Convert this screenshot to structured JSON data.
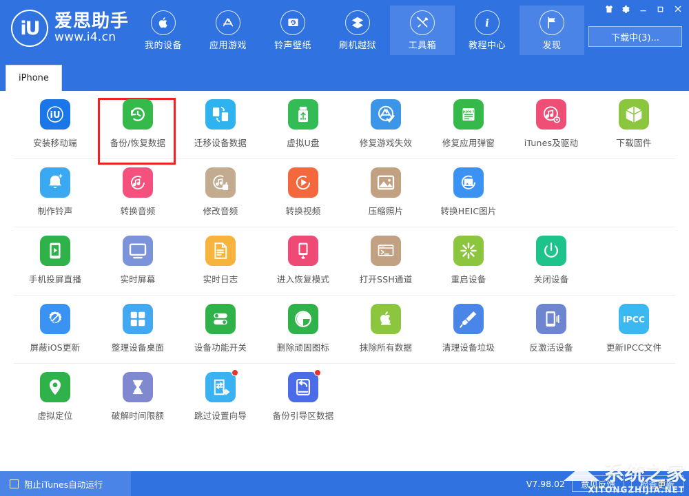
{
  "app": {
    "logo_mark": "iU",
    "logo_name": "爱思助手",
    "logo_url": "www.i4.cn"
  },
  "header": {
    "nav": [
      {
        "label": "我的设备",
        "icon": "apple-icon",
        "active": false
      },
      {
        "label": "应用游戏",
        "icon": "appstore-icon",
        "active": false
      },
      {
        "label": "铃声壁纸",
        "icon": "ringtone-icon",
        "active": false
      },
      {
        "label": "刷机越狱",
        "icon": "flash-icon",
        "active": false
      },
      {
        "label": "工具箱",
        "icon": "toolbox-icon",
        "active": true
      },
      {
        "label": "教程中心",
        "icon": "info-icon",
        "active": false
      },
      {
        "label": "发现",
        "icon": "flag-icon",
        "active": true
      }
    ],
    "window_buttons": [
      {
        "name": "skin-icon",
        "glyph": "shirt"
      },
      {
        "name": "settings-gear-icon",
        "glyph": "gear"
      },
      {
        "name": "minimize-button",
        "glyph": "minimize"
      },
      {
        "name": "maximize-button",
        "glyph": "maximize"
      },
      {
        "name": "close-button",
        "glyph": "close"
      }
    ],
    "download_button": "下载中(3)..."
  },
  "tabs": [
    {
      "label": "iPhone",
      "active": true
    }
  ],
  "toolbox": {
    "rows": [
      {
        "items": [
          {
            "label": "安装移动端",
            "icon": "i4-install-icon",
            "color": "#1b76e8",
            "badge": false
          },
          {
            "label": "备份/恢复数据",
            "icon": "backup-restore-icon",
            "color": "#35b94b",
            "badge": false,
            "highlighted": true
          },
          {
            "label": "迁移设备数据",
            "icon": "migrate-data-icon",
            "color": "#2eb3ef",
            "badge": false
          },
          {
            "label": "虚拟U盘",
            "icon": "usb-disk-icon",
            "color": "#33bb55",
            "badge": false
          },
          {
            "label": "修复游戏失效",
            "icon": "fix-game-icon",
            "color": "#3d95e8",
            "badge": false
          },
          {
            "label": "修复应用弹窗",
            "icon": "appleid-fix-icon",
            "color": "#35b94b",
            "badge": false
          },
          {
            "label": "iTunes及驱动",
            "icon": "itunes-driver-icon",
            "color": "#ef4f77",
            "badge": false
          },
          {
            "label": "下载固件",
            "icon": "firmware-box-icon",
            "color": "#8cc63f",
            "badge": false
          }
        ]
      },
      {
        "items": [
          {
            "label": "制作铃声",
            "icon": "make-ringtone-icon",
            "color": "#3aa9f2",
            "badge": false
          },
          {
            "label": "转换音频",
            "icon": "convert-audio-icon",
            "color": "#f4517f",
            "badge": false
          },
          {
            "label": "修改音频",
            "icon": "edit-audio-icon",
            "color": "#c2ab8e",
            "badge": false
          },
          {
            "label": "转换视频",
            "icon": "convert-video-icon",
            "color": "#f4683e",
            "badge": false
          },
          {
            "label": "压缩照片",
            "icon": "compress-photo-icon",
            "color": "#c2a183",
            "badge": false
          },
          {
            "label": "转换HEIC图片",
            "icon": "heic-convert-icon",
            "color": "#3a92f2",
            "badge": false
          }
        ]
      },
      {
        "items": [
          {
            "label": "手机投屏直播",
            "icon": "screen-cast-icon",
            "color": "#2fb24a",
            "badge": false
          },
          {
            "label": "实时屏幕",
            "icon": "live-screen-icon",
            "color": "#7b93d8",
            "badge": false
          },
          {
            "label": "实时日志",
            "icon": "live-log-icon",
            "color": "#f6b33d",
            "badge": false
          },
          {
            "label": "进入恢复模式",
            "icon": "recovery-mode-icon",
            "color": "#ee4a75",
            "badge": false
          },
          {
            "label": "打开SSH通道",
            "icon": "ssh-terminal-icon",
            "color": "#c2a183",
            "badge": false
          },
          {
            "label": "重启设备",
            "icon": "restart-device-icon",
            "color": "#8cc63f",
            "badge": false
          },
          {
            "label": "关闭设备",
            "icon": "power-off-icon",
            "color": "#1ec28b",
            "badge": false
          }
        ]
      },
      {
        "items": [
          {
            "label": "屏蔽iOS更新",
            "icon": "block-update-icon",
            "color": "#3a92f2",
            "badge": false
          },
          {
            "label": "整理设备桌面",
            "icon": "arrange-home-icon",
            "color": "#42a8ef",
            "badge": false
          },
          {
            "label": "设备功能开关",
            "icon": "feature-toggle-icon",
            "color": "#2fb24a",
            "badge": false
          },
          {
            "label": "删除顽固图标",
            "icon": "delete-icon-icon",
            "color": "#2fb24a",
            "badge": false
          },
          {
            "label": "抹除所有数据",
            "icon": "erase-all-icon",
            "color": "#8cc63f",
            "badge": false
          },
          {
            "label": "清理设备垃圾",
            "icon": "clean-junk-icon",
            "color": "#4a86e8",
            "badge": false
          },
          {
            "label": "反激活设备",
            "icon": "deactivate-icon",
            "color": "#6e86d0",
            "badge": false
          },
          {
            "label": "更新IPCC文件",
            "icon": "ipcc-file-icon",
            "color": "#3ab8ef",
            "badge": false,
            "text": "IPCC"
          }
        ]
      },
      {
        "items": [
          {
            "label": "虚拟定位",
            "icon": "virtual-location-icon",
            "color": "#2fb24a",
            "badge": false
          },
          {
            "label": "破解时间限额",
            "icon": "time-limit-icon",
            "color": "#8088cf",
            "badge": false
          },
          {
            "label": "跳过设置向导",
            "icon": "skip-setup-icon",
            "color": "#3ab2f2",
            "badge": true
          },
          {
            "label": "备份引导区数据",
            "icon": "backup-boot-icon",
            "color": "#4a6ce8",
            "badge": true
          }
        ]
      }
    ]
  },
  "statusbar": {
    "block_itunes_label": "阻止iTunes自动运行",
    "block_itunes_checked": false,
    "version": "V7.98.02",
    "feedback_button": "意见反馈",
    "check_update_button": "检查更新"
  },
  "watermark": {
    "main": "系统之家",
    "sub": "XITONGZHIJIA.NET",
    "center": "",
    "ghost": ""
  },
  "colors": {
    "header_blue": "#2f72e0",
    "nav_active": "#4a84e6",
    "highlight_red": "#ee2222",
    "badge_red": "#e8322a"
  }
}
